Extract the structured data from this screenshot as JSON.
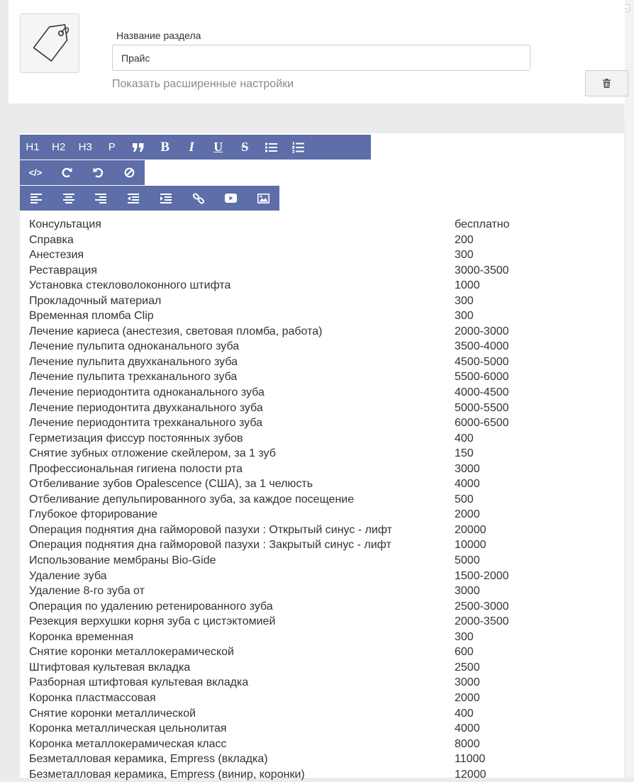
{
  "section": {
    "label": "Название раздела",
    "value": "Прайс",
    "advanced_link": "Показать расширенные настройки"
  },
  "icons": {
    "tag": "tag-icon",
    "trash": "trash-icon",
    "collapse": "minus-icon"
  },
  "toolbar": {
    "row1": [
      "H1",
      "H2",
      "H3",
      "P",
      "quote-icon",
      "bold-icon",
      "italic-icon",
      "underline-icon",
      "strikethrough-icon",
      "bulleted-list-icon",
      "numbered-list-icon"
    ],
    "row2": [
      "code-icon",
      "redo-icon",
      "undo-icon",
      "clear-format-icon"
    ],
    "row3": [
      "align-left-icon",
      "align-center-icon",
      "align-right-icon",
      "outdent-icon",
      "indent-icon",
      "link-icon",
      "video-icon",
      "image-icon"
    ],
    "heading_labels": {
      "h1": "H1",
      "h2": "H2",
      "h3": "H3",
      "p": "P"
    },
    "color": "#5d6ea8"
  },
  "prices": [
    {
      "name": "Консультация",
      "value": "бесплатно"
    },
    {
      "name": "Справка",
      "value": "200"
    },
    {
      "name": "Анестезия",
      "value": "300"
    },
    {
      "name": "Реставрация",
      "value": "3000-3500"
    },
    {
      "name": "Установка стекловолоконного штифта",
      "value": "1000"
    },
    {
      "name": "Прокладочный материал",
      "value": "300"
    },
    {
      "name": "Временная пломба Clip",
      "value": "300"
    },
    {
      "name": "Лечение кариеса (анестезия, световая пломба, работа)",
      "value": "2000-3000"
    },
    {
      "name": "Лечение пульпита одноканального зуба",
      "value": "3500-4000"
    },
    {
      "name": "Лечение пульпита двухканального зуба",
      "value": "4500-5000"
    },
    {
      "name": "Лечение пульпита трехканального зуба",
      "value": "5500-6000"
    },
    {
      "name": "Лечение периодонтита одноканального зуба",
      "value": "4000-4500"
    },
    {
      "name": "Лечение периодонтита двухканального зуба",
      "value": "5000-5500"
    },
    {
      "name": "Лечение периодонтита трехканального зуба",
      "value": "6000-6500"
    },
    {
      "name": "Герметизация фиссур постоянных зубов",
      "value": "400"
    },
    {
      "name": "Снятие зубных отложение скейлером, за 1 зуб",
      "value": "150"
    },
    {
      "name": "Профессиональная гигиена полости рта",
      "value": "3000"
    },
    {
      "name": "Отбеливание зубов Opalescence (США), за 1 челюсть",
      "value": "4000"
    },
    {
      "name": "Отбеливание депульпированного зуба, за каждое посещение",
      "value": "500"
    },
    {
      "name": "Глубокое фторирование",
      "value": "2000"
    },
    {
      "name": "Операция поднятия дна гайморовой пазухи : Открытый синус - лифт",
      "value": "20000"
    },
    {
      "name": "Операция поднятия дна гайморовой пазухи : Закрытый синус - лифт",
      "value": "10000"
    },
    {
      "name": "Использование мембраны Bio-Gide",
      "value": "5000"
    },
    {
      "name": "Удаление зуба",
      "value": "1500-2000"
    },
    {
      "name": "Удаление 8-го зуба     от",
      "value": "3000"
    },
    {
      "name": "Операция по удалению ретенированного зуба",
      "value": "2500-3000"
    },
    {
      "name": "Резекция верхушки корня зуба с цистэктомией",
      "value": "2000-3500"
    },
    {
      "name": "Коронка временная",
      "value": "300"
    },
    {
      "name": "Снятие коронки металлокерамической",
      "value": "600"
    },
    {
      "name": "Штифтовая культевая вкладка",
      "value": "2500"
    },
    {
      "name": "Разборная штифтовая культевая вкладка",
      "value": "3000"
    },
    {
      "name": "Коронка пластмассовая",
      "value": "2000"
    },
    {
      "name": "Снятие коронки металлической",
      "value": "400"
    },
    {
      "name": "Коронка металлическая цельнолитая",
      "value": "4000"
    },
    {
      "name": "Коронка металлокерамическая класс",
      "value": "8000"
    },
    {
      "name": "Безметалловая керамика, Empress (вкладка)",
      "value": "11000"
    },
    {
      "name": "Безметалловая керамика, Empress (винир, коронки)",
      "value": "12000"
    }
  ]
}
